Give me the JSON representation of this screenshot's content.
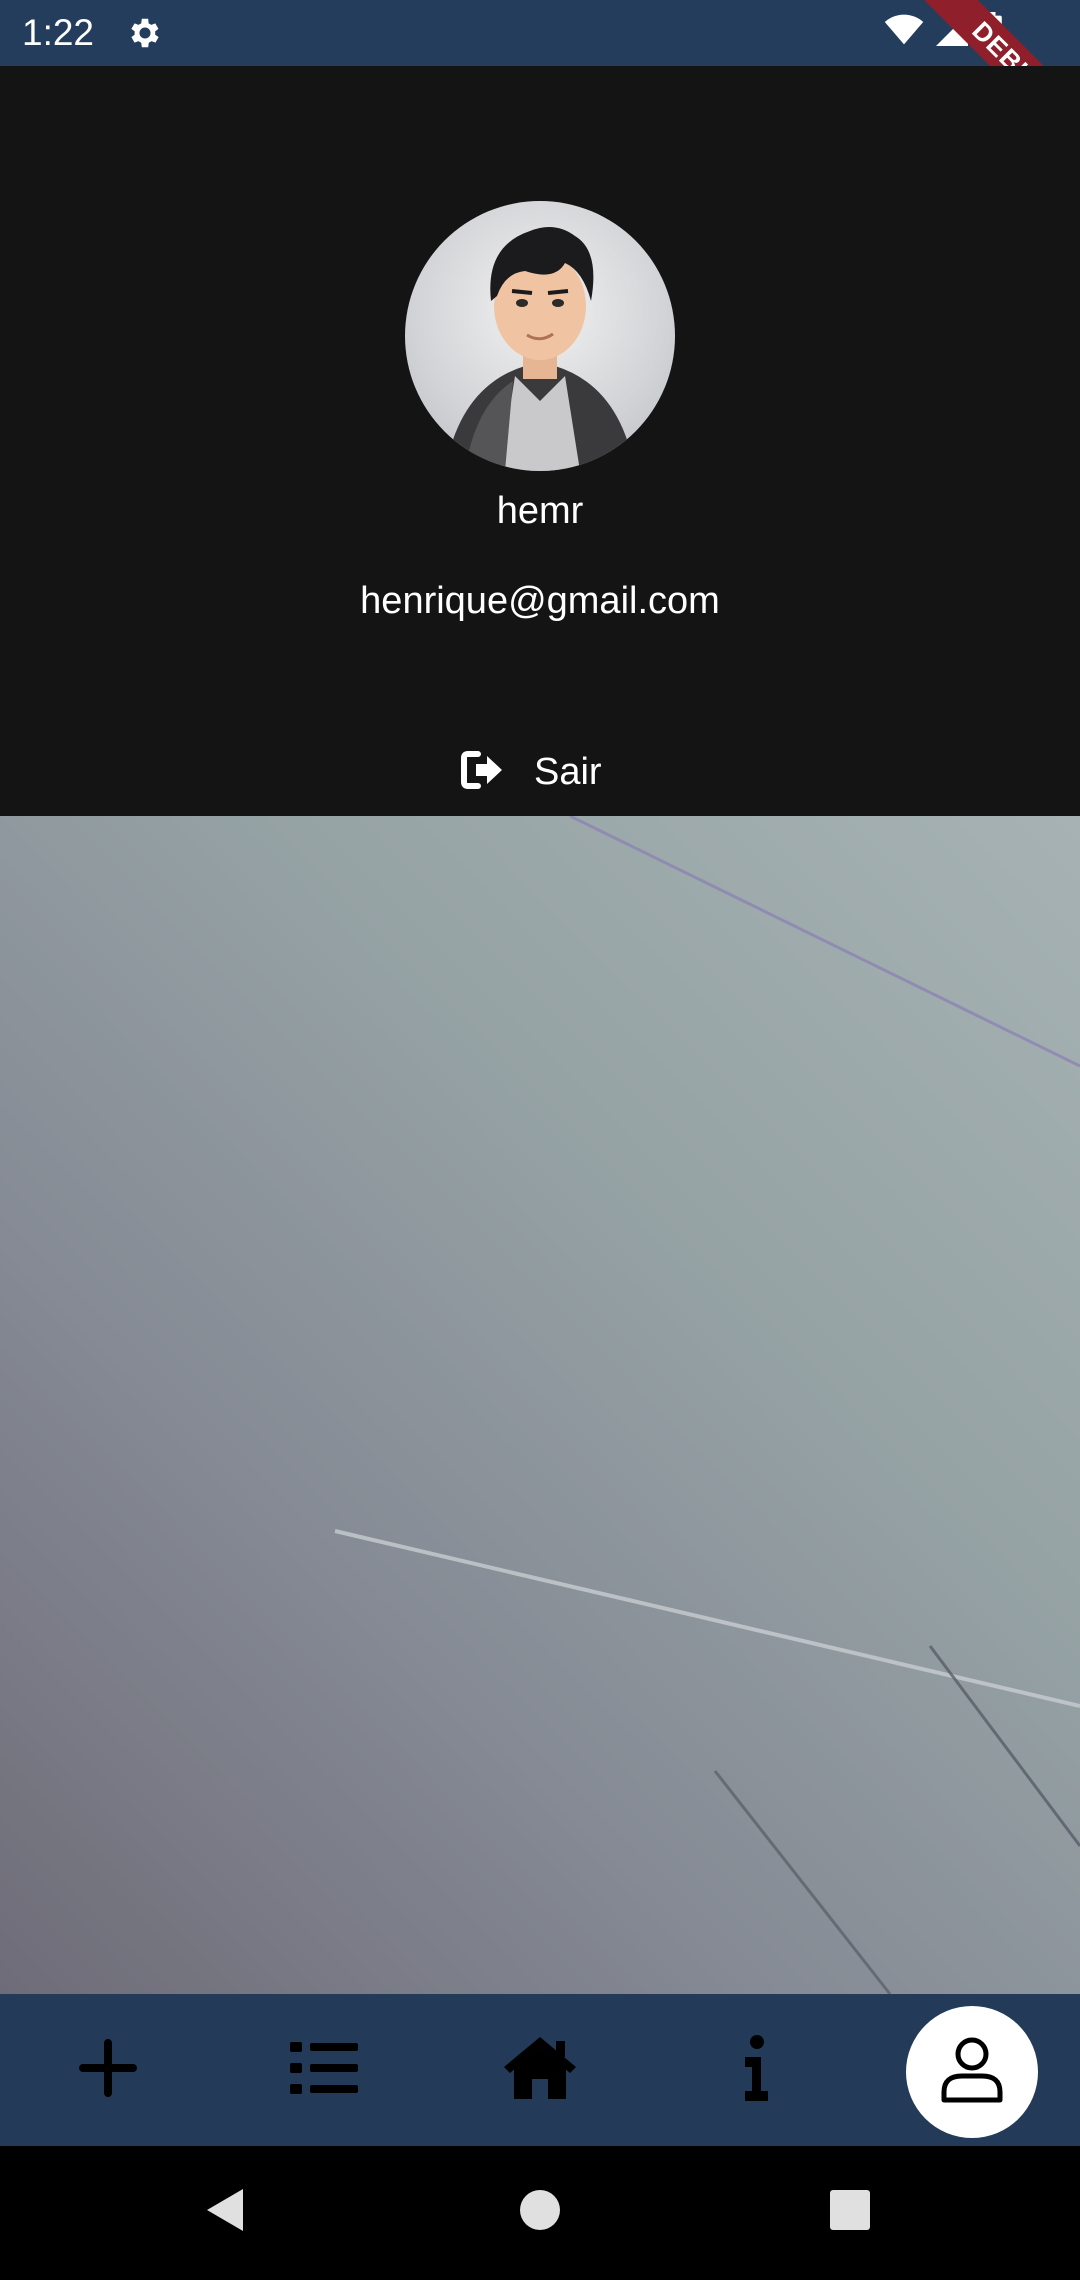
{
  "status_bar": {
    "time": "1:22",
    "icons": [
      "gear-icon",
      "wifi-icon",
      "signal-icon",
      "battery-icon"
    ],
    "debug_banner": "DEBUG"
  },
  "profile": {
    "username": "hemr",
    "email": "henrique@gmail.com",
    "logout_label": "Sair",
    "logout_icon": "sign-out-icon"
  },
  "bottom_nav": {
    "items": [
      {
        "name": "add",
        "icon": "plus-icon"
      },
      {
        "name": "list",
        "icon": "list-icon"
      },
      {
        "name": "home",
        "icon": "home-icon"
      },
      {
        "name": "info",
        "icon": "info-icon"
      },
      {
        "name": "profile",
        "icon": "person-icon",
        "active": true
      }
    ]
  },
  "colors": {
    "status_bar": "#243d5c",
    "panel": "#141414",
    "nav_bar": "#233a58",
    "debug_ribbon": "#8e1f2b"
  }
}
